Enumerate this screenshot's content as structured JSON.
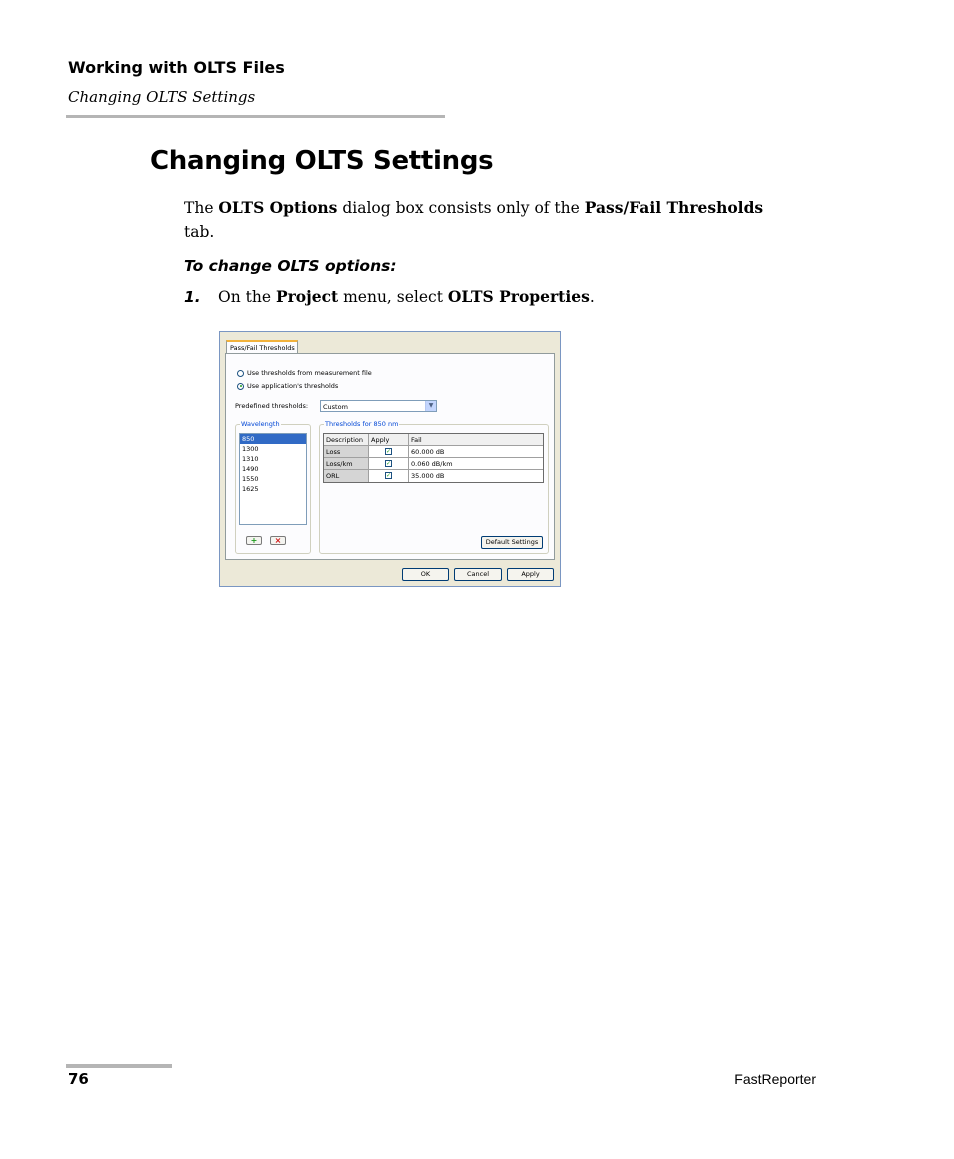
{
  "header": {
    "chapter": "Working with OLTS Files",
    "section": "Changing OLTS Settings"
  },
  "heading": "Changing OLTS Settings",
  "intro": {
    "t1": "The ",
    "b1": "OLTS Options",
    "t2": " dialog box consists only of the ",
    "b2": "Pass/Fail Thresholds",
    "t3": " tab."
  },
  "procedure_title": "To change OLTS options:",
  "step1": {
    "num": "1.",
    "t1": "On the ",
    "b1": "Project",
    "t2": " menu, select ",
    "b2": "OLTS Properties",
    "t3": "."
  },
  "dialog": {
    "tab_label": "Pass/Fail Thresholds",
    "radio_measurement": "Use thresholds from measurement file",
    "radio_application": "Use application's thresholds",
    "selected_radio": "application",
    "predefined_label": "Predefined thresholds:",
    "predefined_value": "Custom",
    "wavelength_caption": "Wavelength",
    "wavelengths": [
      "850",
      "1300",
      "1310",
      "1490",
      "1550",
      "1625"
    ],
    "selected_wavelength": "850",
    "add_icon": "plus-icon",
    "remove_icon": "x-icon",
    "thresholds_caption": "Thresholds for 850 nm",
    "table_headers": [
      "Description",
      "Apply",
      "Fail"
    ],
    "table_rows": [
      {
        "description": "Loss",
        "apply": true,
        "fail": "60.000 dB"
      },
      {
        "description": "Loss/km",
        "apply": true,
        "fail": "0.060 dB/km"
      },
      {
        "description": "ORL",
        "apply": true,
        "fail": "35.000 dB"
      }
    ],
    "default_settings_label": "Default Settings",
    "ok_label": "OK",
    "cancel_label": "Cancel",
    "apply_label": "Apply"
  },
  "footer": {
    "page_number": "76",
    "product": "FastReporter"
  }
}
